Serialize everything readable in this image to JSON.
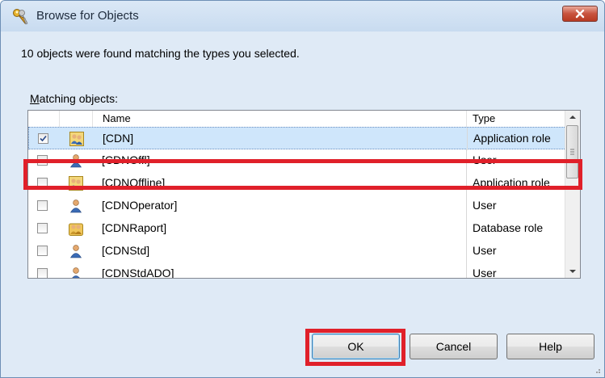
{
  "window": {
    "title": "Browse for Objects",
    "close_label": "Close"
  },
  "message": "10 objects were found matching the types you selected.",
  "matching_label": {
    "accel": "M",
    "rest": "atching objects:"
  },
  "columns": {
    "name": "Name",
    "type": "Type"
  },
  "rows": [
    {
      "name": "[CDN]",
      "type": "Application role",
      "checked": true,
      "selected": true,
      "icon": "application-role-icon"
    },
    {
      "name": "[CDNOffl]",
      "type": "User",
      "checked": false,
      "selected": false,
      "icon": "user-icon"
    },
    {
      "name": "[CDNOffline]",
      "type": "Application role",
      "checked": false,
      "selected": false,
      "icon": "application-role-icon"
    },
    {
      "name": "[CDNOperator]",
      "type": "User",
      "checked": false,
      "selected": false,
      "icon": "user-icon"
    },
    {
      "name": "[CDNRaport]",
      "type": "Database role",
      "checked": false,
      "selected": false,
      "icon": "database-role-icon"
    },
    {
      "name": "[CDNStd]",
      "type": "User",
      "checked": false,
      "selected": false,
      "icon": "user-icon"
    },
    {
      "name": "[CDNStdADO]",
      "type": "User",
      "checked": false,
      "selected": false,
      "icon": "user-icon"
    }
  ],
  "buttons": {
    "ok": "OK",
    "cancel": "Cancel",
    "help": "Help"
  },
  "colors": {
    "highlight": "#e0202a",
    "selection": "#cfe6fb"
  }
}
